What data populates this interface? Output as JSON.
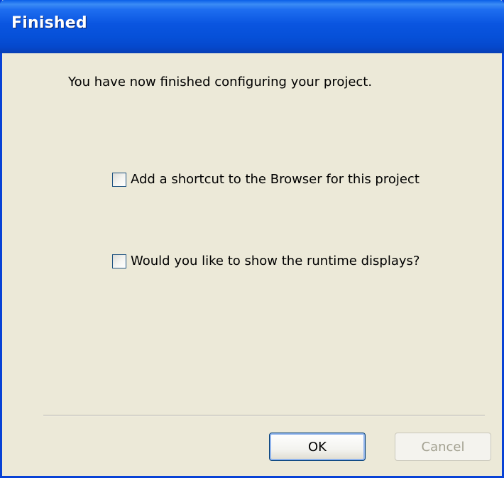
{
  "window": {
    "title": "Finished"
  },
  "main": {
    "message": "You have now finished configuring your project.",
    "checkboxes": [
      {
        "label": "Add a shortcut to the Browser for this project",
        "checked": false
      },
      {
        "label": "Would you like to show the runtime displays?",
        "checked": false
      }
    ]
  },
  "buttons": {
    "ok_label": "OK",
    "cancel_label": "Cancel",
    "cancel_enabled": false
  },
  "colors": {
    "titlebar_blue": "#0a55e0",
    "dialog_background": "#ece9d8",
    "disabled_text": "#a3a191"
  }
}
